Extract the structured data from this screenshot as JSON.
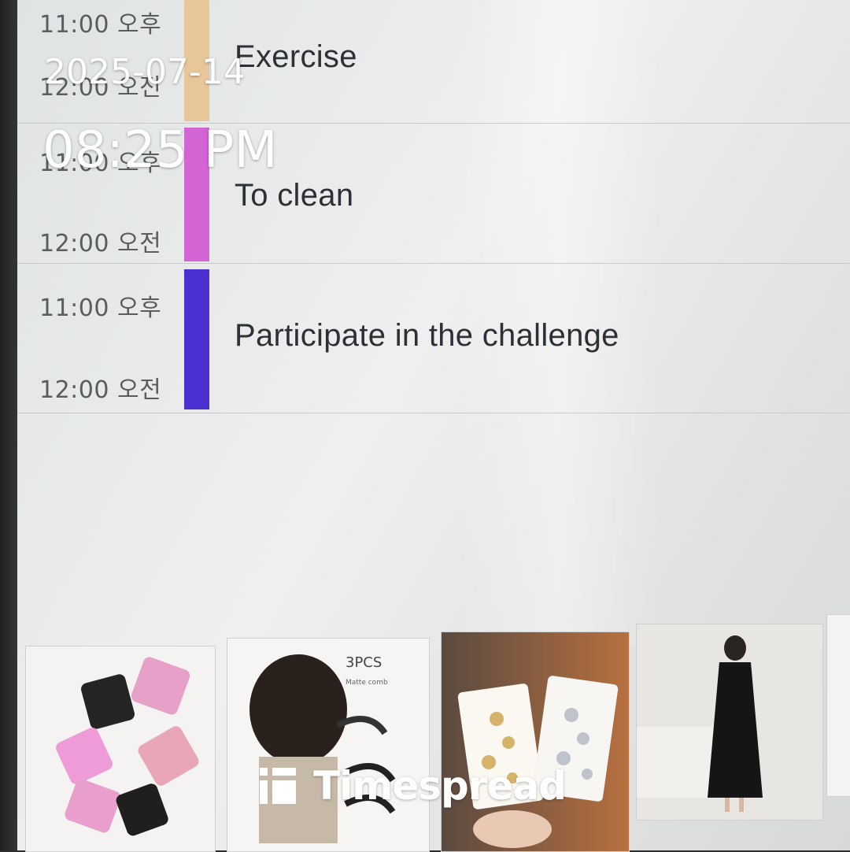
{
  "events": [
    {
      "start": "11:00 오후",
      "end": "12:00 오전",
      "title": "Exercise",
      "color": "#e7c79a"
    },
    {
      "start": "11:00 오후",
      "end": "12:00 오전",
      "title": "To clean",
      "color": "#d265d3"
    },
    {
      "start": "11:00 오후",
      "end": "12:00 오전",
      "title": "Participate in the challenge",
      "color": "#4b2fd0"
    }
  ],
  "products": [
    {
      "name": "hair-comb-clips",
      "text": ""
    },
    {
      "name": "matte-comb",
      "text": "3PCS",
      "subtext": "Matte comb"
    },
    {
      "name": "star-hair-clips",
      "text": ""
    },
    {
      "name": "black-dress-model",
      "text": ""
    }
  ],
  "overlay": {
    "date": "2025-07-14",
    "time": "08:25 PM",
    "brand": "Timespread"
  }
}
